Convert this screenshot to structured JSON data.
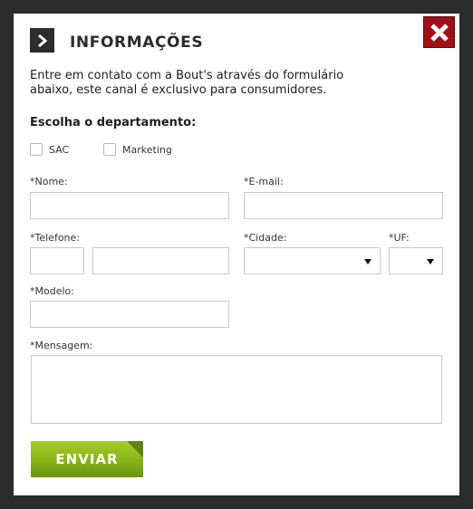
{
  "header": {
    "title": "INFORMAÇÕES",
    "chevron_icon": "chevron-right-icon",
    "close_icon": "close-icon"
  },
  "intro": {
    "line1": "Entre em contato com a Bout's através do formulário",
    "line2": "abaixo, este canal é exclusivo para consumidores."
  },
  "department": {
    "label": "Escolha o departamento:",
    "options": [
      {
        "label": "SAC",
        "checked": false
      },
      {
        "label": "Marketing",
        "checked": false
      }
    ]
  },
  "form": {
    "name_label": "*Nome:",
    "email_label": "*E-mail:",
    "phone_label": "*Telefone:",
    "city_label": "*Cidade:",
    "uf_label": "*UF:",
    "model_label": "*Modelo:",
    "message_label": "*Mensagem:",
    "name_value": "",
    "email_value": "",
    "phone_ddd_value": "",
    "phone_value": "",
    "model_value": "",
    "message_value": "",
    "city_selected": "",
    "uf_selected": ""
  },
  "submit": {
    "label": "ENVIAR"
  },
  "colors": {
    "close_bg": "#9e1116",
    "button_green": "#86b21a",
    "overlay": "#2b2b2b"
  }
}
